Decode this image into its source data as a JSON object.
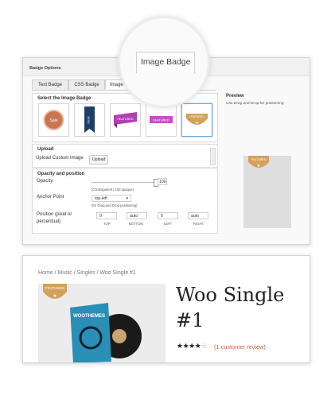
{
  "magnifier": {
    "label": "Image Badge"
  },
  "badge_panel": {
    "title": "Badge Options",
    "tabs": [
      {
        "label": "Text Badge",
        "active": false
      },
      {
        "label": "CSS Badge",
        "active": false
      },
      {
        "label": "Image Badge",
        "active": true
      }
    ],
    "select_section": {
      "title": "Select the Image Badge",
      "options": [
        {
          "name": "sale-badge-round",
          "label": "Sale",
          "selected": false
        },
        {
          "name": "new-ribbon",
          "label": "NEW",
          "selected": false
        },
        {
          "name": "featured-ribbon-purple",
          "label": "FEATURED",
          "selected": false
        },
        {
          "name": "featured-banner-purple",
          "label": "FEATURED",
          "selected": false
        },
        {
          "name": "featured-ribbon-gold",
          "label": "FEATURED",
          "selected": true
        }
      ]
    },
    "upload_section": {
      "title": "Upload",
      "label": "Upload Custom Image",
      "button": "Upload"
    },
    "opacity_section": {
      "title": "Opacity and position",
      "opacity_label": "Opacity",
      "opacity_value": "100",
      "opacity_level": 1.0,
      "opacity_hint": "(0:transparent | 100:opaque)",
      "anchor_label": "Anchor Point",
      "anchor_value": "top-left",
      "anchor_hint": "(for Drag and Drop positioning)",
      "position_label": "Position (pixel or percentual)",
      "positions": [
        {
          "value": "0",
          "caption": "TOP"
        },
        {
          "value": "auto",
          "caption": "BOTTOM"
        },
        {
          "value": "0",
          "caption": "LEFT"
        },
        {
          "value": "auto",
          "caption": "RIGHT"
        }
      ]
    },
    "preview": {
      "title": "Preview",
      "subtitle": "Use Drag and Drop for positioning",
      "badge_label": "FEATURED"
    }
  },
  "product": {
    "breadcrumb": "Home / Music / Singles / Woo Single #1",
    "badge_label": "FEATURED",
    "title": "Woo Single #1",
    "rating": 4,
    "rating_max": 5,
    "review_text": "(1 customer review)",
    "album_text": "WOOTHEMES",
    "colors": {
      "star": "#222222",
      "review_link": "#c0603d",
      "badge": "#d4a15a"
    }
  }
}
